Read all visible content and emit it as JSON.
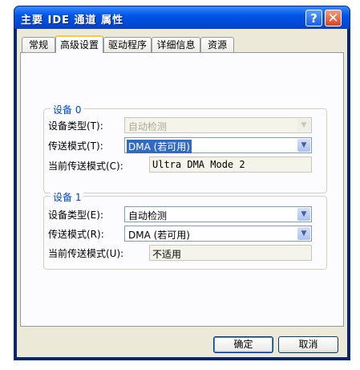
{
  "window": {
    "title": "主要 IDE 通道 属性",
    "help_glyph": "?",
    "close_glyph": "✕"
  },
  "tabs": [
    {
      "label": "常规"
    },
    {
      "label": "高级设置",
      "active": true
    },
    {
      "label": "驱动程序"
    },
    {
      "label": "详细信息"
    },
    {
      "label": "资源"
    }
  ],
  "device0": {
    "legend": "设备 0",
    "type_label": "设备类型(T):",
    "type_value": "自动检测",
    "type_enabled": false,
    "mode_label": "传送模式(T):",
    "mode_value": "DMA (若可用)",
    "current_label": "当前传送模式(C):",
    "current_value": "Ultra DMA Mode 2"
  },
  "device1": {
    "legend": "设备 1",
    "type_label": "设备类型(E):",
    "type_value": "自动检测",
    "mode_label": "传送模式(R):",
    "mode_value": "DMA (若可用)",
    "current_label": "当前传送模式(U):",
    "current_value": "不适用"
  },
  "buttons": {
    "ok": "确定",
    "cancel": "取消"
  },
  "icons": {
    "dropdown": "chevron-down-icon"
  }
}
